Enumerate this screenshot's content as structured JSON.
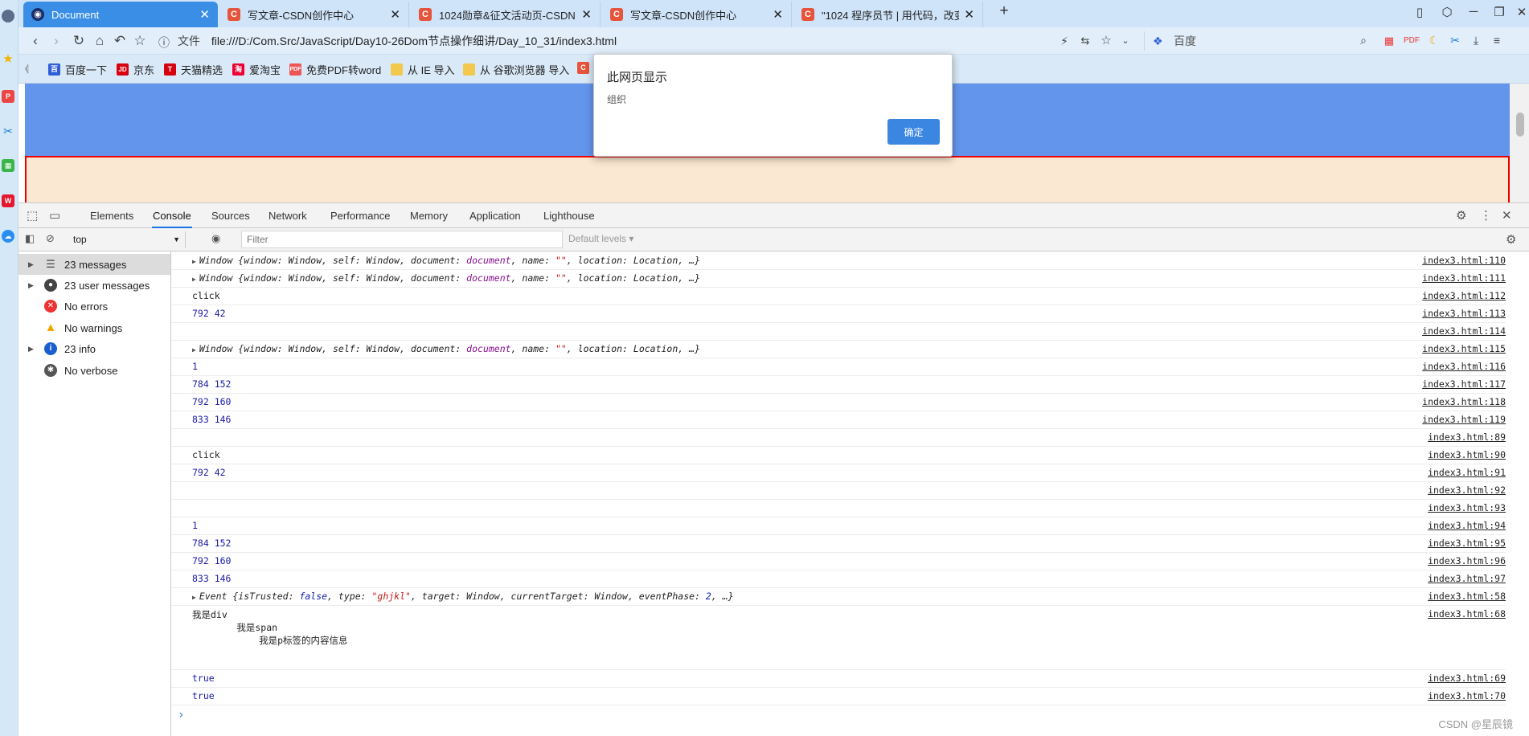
{
  "left_strip": {
    "icons": [
      "avatar-icon",
      "star-icon",
      "pdf-icon",
      "scissors-icon",
      "grid-icon",
      "weibo-icon",
      "cloud-icon"
    ]
  },
  "tabs": [
    {
      "title": "Document",
      "active": true
    },
    {
      "title": "写文章-CSDN创作中心",
      "active": false
    },
    {
      "title": "1024勋章&征文活动页-CSDN",
      "active": false
    },
    {
      "title": "写文章-CSDN创作中心",
      "active": false
    },
    {
      "title": "\"1024 程序员节 | 用代码，改变世",
      "active": false
    }
  ],
  "tab_icon_letter": "C",
  "address": {
    "file_label": "文件",
    "url": "file:///D:/Com.Src/JavaScript/Day10-26Dom节点操作细讲/Day_10_31/index3.html",
    "search_engine": "百度"
  },
  "bookmarks": [
    {
      "label": "百度一下",
      "color": "#2f5ed8",
      "glyph": "百"
    },
    {
      "label": "京东",
      "color": "#d6000f",
      "glyph": "JD"
    },
    {
      "label": "天猫精选",
      "color": "#d6000f",
      "glyph": "T"
    },
    {
      "label": "爱淘宝",
      "color": "#e03"
    },
    {
      "label": "免费PDF转word",
      "color": "#e55"
    },
    {
      "label": "从 IE 导入",
      "color": "#f2c94c"
    },
    {
      "label": "从 谷歌浏览器 导入",
      "color": "#f2c94c"
    }
  ],
  "dialog": {
    "title": "此网页显示",
    "message": "组织",
    "ok_label": "确定"
  },
  "devtools": {
    "tabs": [
      "Elements",
      "Console",
      "Sources",
      "Network",
      "Performance",
      "Memory",
      "Application",
      "Lighthouse"
    ],
    "active_tab": "Console",
    "context": "top",
    "filter_placeholder": "Filter",
    "levels": "Default levels ▾"
  },
  "sidebar": [
    {
      "label": "23 messages",
      "icon": "list-icon",
      "expandable": true,
      "selected": true
    },
    {
      "label": "23 user messages",
      "icon": "user-icon",
      "expandable": true
    },
    {
      "label": "No errors",
      "icon": "error-icon",
      "expandable": false
    },
    {
      "label": "No warnings",
      "icon": "warning-icon",
      "expandable": false
    },
    {
      "label": "23 info",
      "icon": "info-icon",
      "expandable": true
    },
    {
      "label": "No verbose",
      "icon": "bug-icon",
      "expandable": false
    }
  ],
  "console_rows": [
    {
      "type": "window",
      "src": "index3.html:110"
    },
    {
      "type": "window",
      "src": "index3.html:111"
    },
    {
      "type": "text",
      "text": "click",
      "src": "index3.html:112"
    },
    {
      "type": "num",
      "text": "792 42",
      "src": "index3.html:113"
    },
    {
      "type": "empty",
      "src": "index3.html:114"
    },
    {
      "type": "window",
      "src": "index3.html:115"
    },
    {
      "type": "num",
      "text": "1",
      "src": "index3.html:116"
    },
    {
      "type": "num",
      "text": "784 152",
      "src": "index3.html:117"
    },
    {
      "type": "num",
      "text": "792 160",
      "src": "index3.html:118"
    },
    {
      "type": "num",
      "text": "833 146",
      "src": "index3.html:119"
    },
    {
      "type": "empty",
      "src": "index3.html:89"
    },
    {
      "type": "text",
      "text": "click",
      "src": "index3.html:90"
    },
    {
      "type": "num",
      "text": "792 42",
      "src": "index3.html:91"
    },
    {
      "type": "empty",
      "src": "index3.html:92"
    },
    {
      "type": "empty",
      "src": "index3.html:93"
    },
    {
      "type": "num",
      "text": "1",
      "src": "index3.html:94"
    },
    {
      "type": "num",
      "text": "784 152",
      "src": "index3.html:95"
    },
    {
      "type": "num",
      "text": "792 160",
      "src": "index3.html:96"
    },
    {
      "type": "num",
      "text": "833 146",
      "src": "index3.html:97"
    },
    {
      "type": "event",
      "src": "index3.html:58"
    },
    {
      "type": "multi",
      "text": "我是div\n        我是span\n            我是p标签的内容信息",
      "src": "index3.html:68"
    },
    {
      "type": "num",
      "text": "true",
      "src": "index3.html:69"
    },
    {
      "type": "num",
      "text": "true",
      "src": "index3.html:70"
    }
  ],
  "window_obj": {
    "prefix": "Window {window: Window, self: Window, document: ",
    "document": "document",
    "mid": ", name: ",
    "name_val": "\"\"",
    "suffix": ", location: Location, …}"
  },
  "event_obj": {
    "prefix": "Event {isTrusted: ",
    "trusted": "false",
    "mid1": ", type: ",
    "type_val": "\"ghjkl\"",
    "mid2": ", target: Window, currentTarget: Window, eventPhase: ",
    "phase": "2",
    "suffix": ", …}"
  },
  "watermark": "CSDN @星辰镜"
}
